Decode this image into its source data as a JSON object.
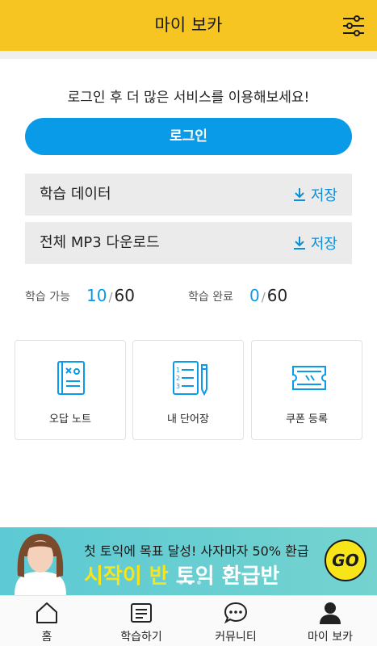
{
  "header": {
    "title": "마이 보카",
    "settings_icon": "sliders-icon"
  },
  "login": {
    "prompt": "로그인 후 더 많은 서비스를 이용해보세요!",
    "button_label": "로그인"
  },
  "downloads": [
    {
      "label": "학습 데이터",
      "action": "저장",
      "icon": "download-icon"
    },
    {
      "label": "전체 MP3 다운로드",
      "action": "저장",
      "icon": "download-icon"
    }
  ],
  "stats": {
    "available": {
      "label": "학습 가능",
      "current": "10",
      "separator": "/",
      "total": "60"
    },
    "completed": {
      "label": "학습 완료",
      "current": "0",
      "separator": "/",
      "total": "60"
    }
  },
  "cards": [
    {
      "label": "오답 노트",
      "icon": "wrong-note-icon"
    },
    {
      "label": "내 단어장",
      "icon": "word-list-icon"
    },
    {
      "label": "쿠폰 등록",
      "icon": "coupon-icon"
    }
  ],
  "banner": {
    "line1": "첫 토익에 목표 달성! 사자마자 50% 환급",
    "line2_highlight": "시작이 반",
    "line2_rest": "토익 환급반",
    "go_label": "GO"
  },
  "tabs": [
    {
      "label": "홈",
      "icon": "home-icon"
    },
    {
      "label": "학습하기",
      "icon": "study-icon"
    },
    {
      "label": "커뮤니티",
      "icon": "chat-bubble-icon"
    },
    {
      "label": "마이 보카",
      "icon": "person-icon"
    }
  ],
  "colors": {
    "header": "#f7c521",
    "accent": "#0a9be8",
    "banner": "#5cc9d4"
  }
}
